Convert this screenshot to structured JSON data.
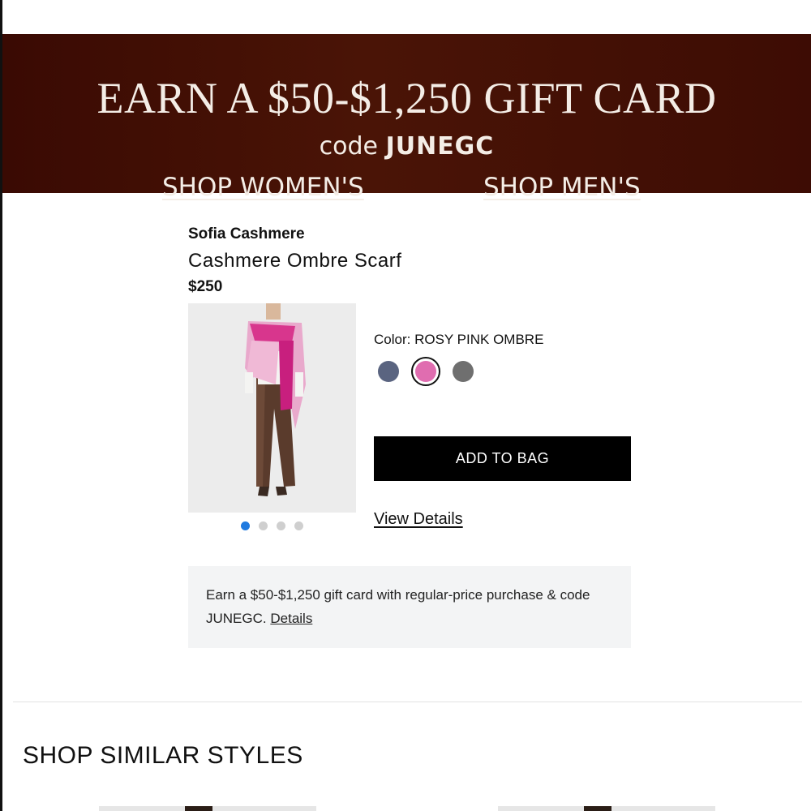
{
  "promo_banner": {
    "headline": "EARN A $50-$1,250 GIFT CARD",
    "code_prefix": "code",
    "code": "JUNEGC",
    "shop_women_label": "SHOP WOMEN'S",
    "shop_men_label": "SHOP MEN'S",
    "background_color": "#3f0e04"
  },
  "product": {
    "brand": "Sofia Cashmere",
    "name": "Cashmere Ombre Scarf",
    "price": "$250",
    "color_label": "Color: ROSY PINK OMBRE",
    "swatches": [
      {
        "name": "navy",
        "color": "#5a6480",
        "selected": false
      },
      {
        "name": "rosy-pink-ombre",
        "color": "#e06db0",
        "selected": true
      },
      {
        "name": "gray",
        "color": "#6f6f6f",
        "selected": false
      }
    ],
    "image_count": 4,
    "active_image": 1,
    "add_to_bag_label": "ADD TO BAG",
    "view_details_label": "View Details"
  },
  "promo_box": {
    "text": "Earn a $50-$1,250 gift card with regular-price purchase & code JUNEGC.",
    "details_label": "Details"
  },
  "similar": {
    "heading": "SHOP SIMILAR STYLES"
  }
}
